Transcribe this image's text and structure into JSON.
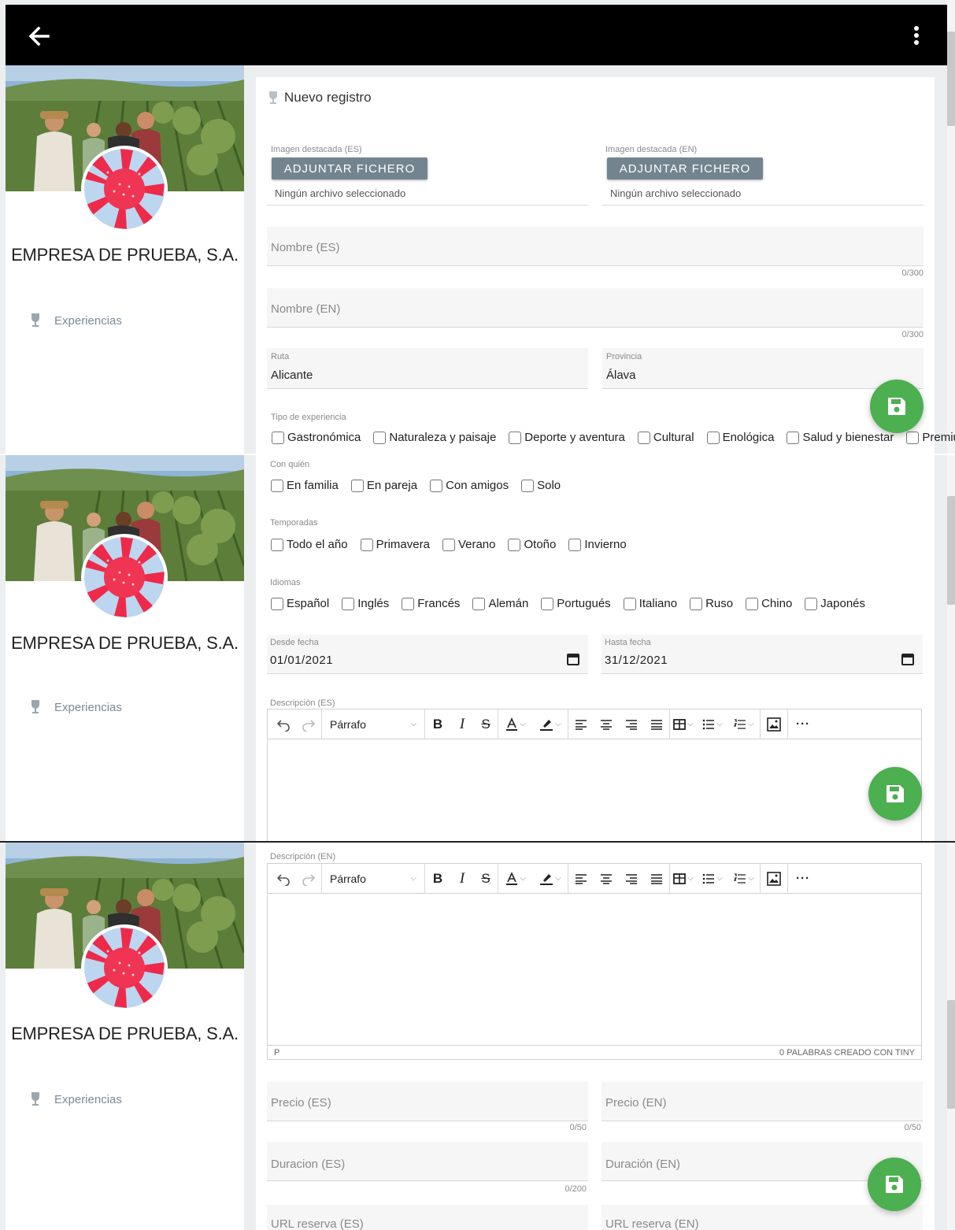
{
  "sidebar": {
    "company_name": "EMPRESA DE PRUEBA, S.A.",
    "nav_experiences": "Experiencias"
  },
  "form": {
    "title": "Nuevo registro",
    "image_es_label": "Imagen destacada (ES)",
    "image_en_label": "Imagen destacada (EN)",
    "upload_button": "ADJUNTAR FICHERO",
    "no_file": "Ningún archivo seleccionado",
    "name_es": "Nombre (ES)",
    "name_en": "Nombre (EN)",
    "name_counter": "0/300",
    "route_label": "Ruta",
    "route_value": "Alicante",
    "province_label": "Provincia",
    "province_value": "Álava",
    "experience_type_label": "Tipo de experiencia",
    "experience_types": [
      "Gastronómica",
      "Naturaleza y paisaje",
      "Deporte y aventura",
      "Cultural",
      "Enológica",
      "Salud y bienestar",
      "Premium"
    ],
    "with_whom_label": "Con quién",
    "with_whom": [
      "En familia",
      "En pareja",
      "Con amigos",
      "Solo"
    ],
    "seasons_label": "Temporadas",
    "seasons": [
      "Todo el año",
      "Primavera",
      "Verano",
      "Otoño",
      "Invierno"
    ],
    "languages_label": "Idiomas",
    "languages": [
      "Español",
      "Inglés",
      "Francés",
      "Alemán",
      "Portugués",
      "Italiano",
      "Ruso",
      "Chino",
      "Japonés"
    ],
    "from_date_label": "Desde fecha",
    "from_date_value": "01/01/2021",
    "to_date_label": "Hasta fecha",
    "to_date_value": "31/12/2021",
    "description_es_label": "Descripción (ES)",
    "description_en_label": "Descripción (EN)",
    "editor_format": "Párrafo",
    "editor_path": "P",
    "editor_status": "0 PALABRAS  CREADO CON TINY",
    "price_es": "Precio (ES)",
    "price_en": "Precio (EN)",
    "price_counter": "0/50",
    "duration_es": "Duracion (ES)",
    "duration_en": "Duración (EN)",
    "duration_counter": "0/200",
    "booking_url_es": "URL reserva (ES)",
    "booking_url_en": "URL reserva (EN)"
  },
  "colors": {
    "fab": "#4caf50",
    "upload_button": "#73848f",
    "appbar": "#000000"
  }
}
